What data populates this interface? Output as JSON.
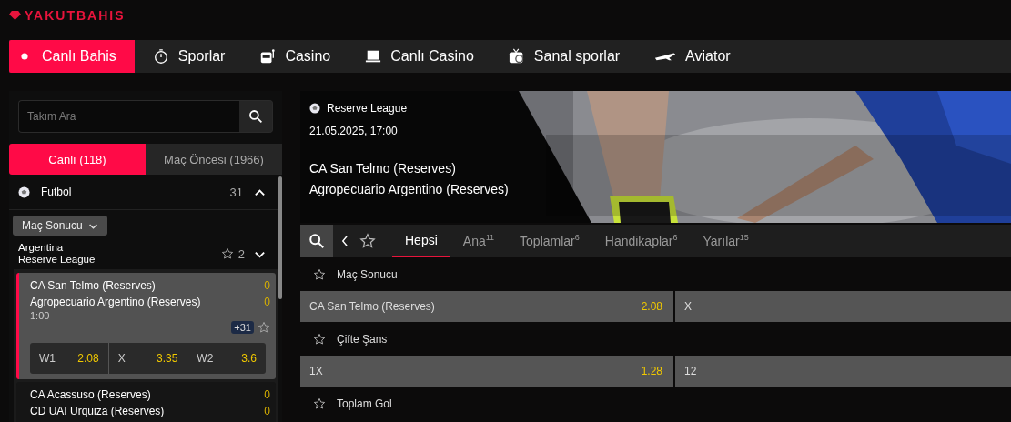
{
  "logo": "YAKUTBAHIS",
  "nav": [
    {
      "label": "Canlı Bahis",
      "selected": true
    },
    {
      "label": "Sporlar",
      "selected": false
    },
    {
      "label": "Casino",
      "selected": false
    },
    {
      "label": "Canlı Casino",
      "selected": false
    },
    {
      "label": "Sanal sporlar",
      "selected": false
    },
    {
      "label": "Aviator",
      "selected": false
    }
  ],
  "sidebar": {
    "search": {
      "placeholder": "Takım Ara"
    },
    "tabs": [
      {
        "label": "Canlı (118)",
        "selected": true
      },
      {
        "label": "Maç Öncesi (1966)",
        "selected": false
      }
    ],
    "sport": {
      "name": "Futbol",
      "count": "31",
      "expanded": true
    },
    "market_dropdown": "Maç Sonucu",
    "league": {
      "country": "Argentina",
      "name": "Reserve League",
      "favorites": "2",
      "expanded": false
    },
    "matches": [
      {
        "home": "CA San Telmo (Reserves)",
        "away": "Agropecuario Argentino (Reserves)",
        "home_score": "0",
        "away_score": "0",
        "time": "1:00",
        "more": "+31",
        "selected": true,
        "odds": [
          {
            "label": "W1",
            "value": "2.08"
          },
          {
            "label": "X",
            "value": "3.35"
          },
          {
            "label": "W2",
            "value": "3.6"
          }
        ]
      },
      {
        "home": "CA Acassuso (Reserves)",
        "away": "CD UAI Urquiza (Reserves)",
        "home_score": "0",
        "away_score": "0",
        "selected": false
      }
    ]
  },
  "event": {
    "league": "Reserve League",
    "datetime": "21.05.2025, 17:00",
    "home": "CA San Telmo (Reserves)",
    "away": "Agropecuario Argentino (Reserves)"
  },
  "market_tabs": [
    {
      "label": "Hepsi",
      "selected": true
    },
    {
      "label": "Ana",
      "count": "11",
      "selected": false
    },
    {
      "label": "Toplamlar",
      "count": "6",
      "selected": false
    },
    {
      "label": "Handikaplar",
      "count": "6",
      "selected": false
    },
    {
      "label": "Yarılar",
      "count": "15",
      "selected": false
    }
  ],
  "markets": [
    {
      "title": "Maç Sonucu",
      "outcomes": [
        {
          "label": "CA San Telmo (Reserves)",
          "odds": "2.08"
        },
        {
          "label": "X"
        }
      ]
    },
    {
      "title": "Çifte Şans",
      "outcomes": [
        {
          "label": "1X",
          "odds": "1.28"
        },
        {
          "label": "12"
        }
      ]
    },
    {
      "title": "Toplam Gol"
    }
  ]
}
